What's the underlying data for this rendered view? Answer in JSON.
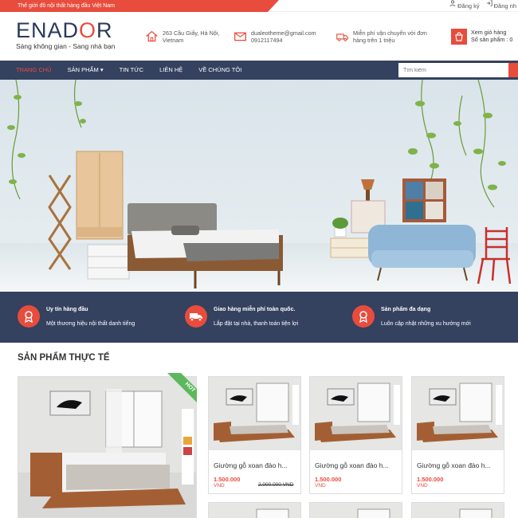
{
  "topbar": {
    "promo": "Thế giới đồ nội thất hàng đầu Việt Nam",
    "register": "Đăng ký",
    "login": "Đăng nh"
  },
  "logo": {
    "brand_a": "ENAD",
    "brand_o": "O",
    "brand_b": "R",
    "tagline": "Sáng không gian - Sang nhà bạn"
  },
  "header": {
    "address_1": "263 Cầu Giấy, Hà Nội,",
    "address_2": "Vietnam",
    "email": "dualeotheme@gmail.com",
    "phone": "0912117494",
    "ship_1": "Miễn phí vận chuyển với đơn",
    "ship_2": "hàng trên 1 triệu",
    "cart_title": "Xem giỏ hàng",
    "cart_count": "Số sản phẩm : 0"
  },
  "nav": {
    "items": [
      "Trang chủ",
      "Sản phẩm ▾",
      "Tin tức",
      "Liên hệ",
      "Về chúng tôi"
    ],
    "search_placeholder": "Tìm kiếm"
  },
  "features": [
    {
      "title": "Uy tín hàng đầu",
      "desc": "Một thương hiệu nội thất danh tiếng"
    },
    {
      "title": "Giao hàng miễn phí toàn quốc.",
      "desc": "Lắp đặt tại nhà, thanh toán tiện lợi"
    },
    {
      "title": "Sản phẩm đa dạng",
      "desc": "Luôn cập nhật những xu hướng mới"
    }
  ],
  "products": {
    "section_title": "SẢN PHẨM THỰC TẾ",
    "hot_label": "HOT",
    "items": [
      {
        "name": "Giường gỗ xoan đào h...",
        "price": "1.500.000",
        "currency": "VND",
        "old_price": "2.000.000 VND"
      },
      {
        "name": "Giường gỗ xoan đào h...",
        "price": "1.500.000",
        "currency": "VND",
        "old_price": ""
      },
      {
        "name": "Giường gỗ xoan đào h...",
        "price": "1.500.000",
        "currency": "VND",
        "old_price": ""
      }
    ]
  },
  "colors": {
    "accent": "#e84c3d",
    "navy": "#34415f"
  },
  "icons": [
    "user-icon",
    "login-icon",
    "home-icon",
    "mail-icon",
    "truck-icon",
    "cart-icon",
    "search-icon",
    "award-icon"
  ]
}
